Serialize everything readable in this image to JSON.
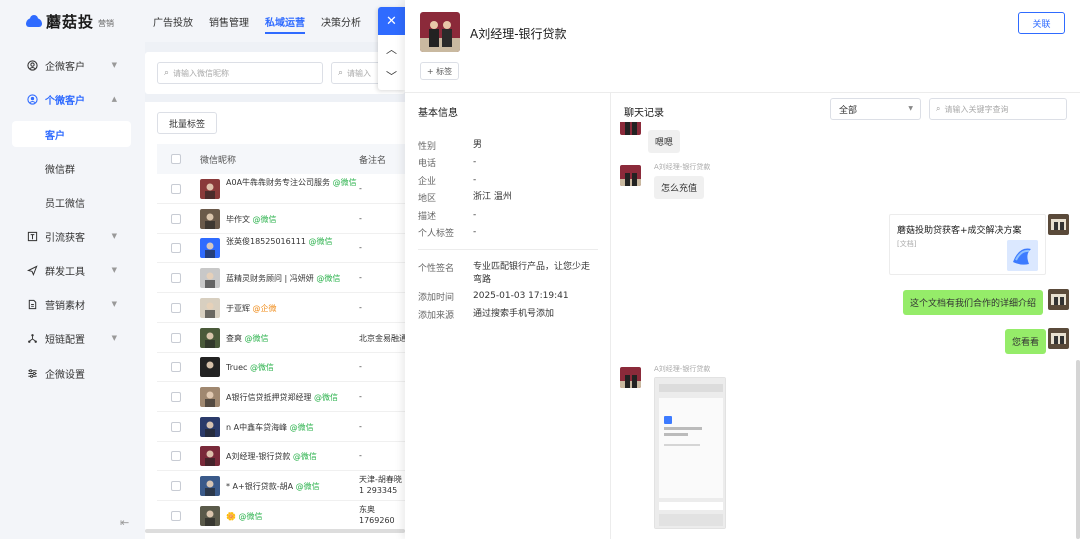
{
  "brand": {
    "name": "蘑菇投",
    "sub": "营销"
  },
  "top_nav": {
    "tabs": [
      "广告投放",
      "销售管理",
      "私域运营",
      "决策分析"
    ],
    "active_index": 2
  },
  "sidebar": {
    "items": [
      {
        "label": "企微客户",
        "icon": "user-circle-icon",
        "has_caret": true,
        "caret": "▼"
      },
      {
        "label": "个微客户",
        "icon": "user-circle-icon",
        "has_caret": true,
        "caret": "▲",
        "active": true
      },
      {
        "label": "引流获客",
        "icon": "funnel-icon",
        "has_caret": true,
        "caret": "▼"
      },
      {
        "label": "群发工具",
        "icon": "send-icon",
        "has_caret": true,
        "caret": "▼"
      },
      {
        "label": "营销素材",
        "icon": "document-icon",
        "has_caret": true,
        "caret": "▼"
      },
      {
        "label": "短链配置",
        "icon": "link-icon",
        "has_caret": true,
        "caret": "▼"
      },
      {
        "label": "企微设置",
        "icon": "sliders-icon",
        "has_caret": false,
        "caret": ""
      }
    ],
    "sub_items": [
      "客户",
      "微信群",
      "员工微信"
    ],
    "active_sub_index": 0,
    "collapse_icon": "⇤"
  },
  "filters": {
    "nickname_placeholder": "请输入微信昵称",
    "second_placeholder": "请输入"
  },
  "table": {
    "batch_button": "批量标签",
    "columns": [
      "微信昵称",
      "备注名"
    ],
    "rows": [
      {
        "name": "A0A牛犇犇财务专注公司服务",
        "src": "@微信",
        "src_type": "wx",
        "remark": "-",
        "avatar_color": "#8a3a3a"
      },
      {
        "name": "毕作文",
        "src": "@微信",
        "src_type": "wx",
        "remark": "-",
        "avatar_color": "#6b5a4a"
      },
      {
        "name": "张英俊18525016111",
        "src": "@微信",
        "src_type": "wx",
        "remark": "-",
        "avatar_color": "#2f6bff"
      },
      {
        "name": "蓝精灵财务顾问 | 冯妍妍",
        "src": "@微信",
        "src_type": "wx",
        "remark": "-",
        "avatar_color": "#c8c8c8"
      },
      {
        "name": "于亚辉",
        "src": "@企微",
        "src_type": "qw",
        "remark": "-",
        "avatar_color": "#d8cfc0"
      },
      {
        "name": "查爽",
        "src": "@微信",
        "src_type": "wx",
        "remark": "北京金易融通",
        "avatar_color": "#4a5a3a"
      },
      {
        "name": "Truec",
        "src": "@微信",
        "src_type": "wx",
        "remark": "-",
        "avatar_color": "#222222"
      },
      {
        "name": "A银行信贷抵押贷郑经理",
        "src": "@微信",
        "src_type": "wx",
        "remark": "-",
        "avatar_color": "#a08870"
      },
      {
        "name": "n A中鑫车贷海峰",
        "src": "@微信",
        "src_type": "wx",
        "remark": "-",
        "avatar_color": "#2a3a6a"
      },
      {
        "name": "A刘经理-银行贷款",
        "src": "@微信",
        "src_type": "wx",
        "remark": "-",
        "avatar_color": "#7a2a3a"
      },
      {
        "name": "*  A+银行贷款-胡A",
        "src": "@微信",
        "src_type": "wx",
        "remark": "天津-胡春晓1 293345",
        "avatar_color": "#3a5a8a"
      },
      {
        "name": "🌼",
        "src": "@微信",
        "src_type": "wx",
        "remark": "东奥1769260",
        "avatar_color": "#5a5a4a"
      }
    ]
  },
  "float_bar": {
    "close": "✕",
    "up": "︿",
    "down": "﹀"
  },
  "drawer": {
    "title": "A刘经理-银行贷款",
    "close_button": "关联",
    "tag_button": "+ 标签",
    "basic_info_title": "基本信息",
    "fields": [
      {
        "label": "性别",
        "value": "男"
      },
      {
        "label": "电话",
        "value": "-"
      },
      {
        "label": "企业",
        "value": "-"
      },
      {
        "label": "地区",
        "value": "浙江 温州"
      },
      {
        "label": "描述",
        "value": "-"
      },
      {
        "label": "个人标签",
        "value": "-"
      }
    ],
    "extra_fields": [
      {
        "label": "个性签名",
        "value": "专业匹配银行产品，让您少走弯路"
      },
      {
        "label": "添加时间",
        "value": "2025-01-03 17:19:41"
      },
      {
        "label": "添加来源",
        "value": "通过搜索手机号添加"
      }
    ],
    "chat": {
      "title": "聊天记录",
      "filter_value": "全部",
      "keyword_placeholder": "请输入关键字查询",
      "messages": [
        {
          "text": "嗯嗯"
        },
        {
          "sender": "A刘经理-银行贷款",
          "text": "怎么充值"
        },
        {
          "doc_title": "蘑菇投助贷获客+成交解决方案",
          "doc_type": "[文档]"
        },
        {
          "text": "这个文档有我们合作的详细介绍"
        },
        {
          "text": "您看看"
        },
        {
          "sender": "A刘经理-银行贷款",
          "image_caption": "蘑菇投助贷获客+成交解决方案"
        }
      ]
    }
  }
}
